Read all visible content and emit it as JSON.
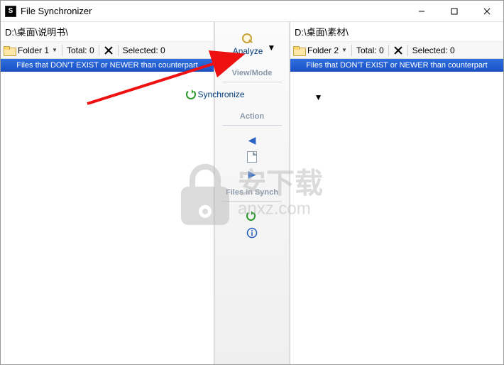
{
  "window": {
    "title": "File Synchronizer"
  },
  "left": {
    "path": "D:\\桌面\\说明书\\",
    "folder_label": "Folder 1",
    "total_label": "Total: 0",
    "selected_label": "Selected: 0",
    "banner": "Files that DON'T EXIST or NEWER than counterpart"
  },
  "right": {
    "path": "D:\\桌面\\素材\\",
    "folder_label": "Folder 2",
    "total_label": "Total: 0",
    "selected_label": "Selected: 0",
    "banner": "Files that DON'T EXIST or NEWER than counterpart"
  },
  "center": {
    "analyze": "Analyze",
    "view_mode_label": "View/Mode",
    "synchronize": "Synchronize",
    "action_label": "Action",
    "files_in_synch_label": "Files in Synch"
  },
  "watermark": {
    "cn": "安下载",
    "en": "anxz.com"
  }
}
